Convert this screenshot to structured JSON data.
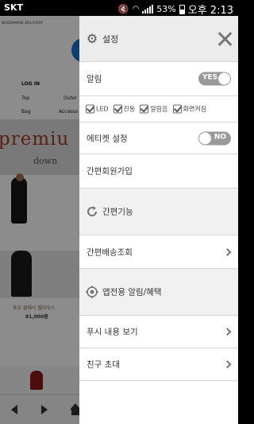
{
  "status_bar": {
    "carrier": "SKT",
    "battery": "53%",
    "time": "오후 2:13"
  },
  "background_page": {
    "top_nav": "BOOKMARK   DELIVERY",
    "login": "LOG IN",
    "categories": [
      "Top",
      "Outer",
      "Bag",
      "Accesso"
    ],
    "promo_big": "premiu",
    "promo_sub": "down",
    "product_name": "포우 클래식 벨라우스",
    "product_price": "81,000원"
  },
  "drawer": {
    "title": "설정",
    "items": {
      "notifications": {
        "label": "알림",
        "toggle": "YES",
        "state": "on"
      },
      "checks": [
        "LED",
        "진동",
        "알림음",
        "화면켜짐"
      ],
      "etiquette": {
        "label": "에티켓 설정",
        "toggle": "NO",
        "state": "off"
      },
      "quick_signup": {
        "label": "간편회원가입"
      },
      "quick_functions": {
        "label": "간편기능"
      },
      "delivery_lookup": {
        "label": "간편배송조회"
      },
      "app_alerts": {
        "label": "앱전용 알림/혜택"
      },
      "push_content": {
        "label": "푸시 내용 보기"
      },
      "invite_friends": {
        "label": "친구 초대"
      }
    }
  },
  "icons": {
    "settings": "gear-icon",
    "close": "close-icon",
    "refresh": "refresh-icon",
    "target": "target-icon",
    "chevron": "chevron-right-icon"
  },
  "colors": {
    "header_bg": "#ececec",
    "row_grey": "#f1f1f1",
    "toggle": "#999999"
  }
}
